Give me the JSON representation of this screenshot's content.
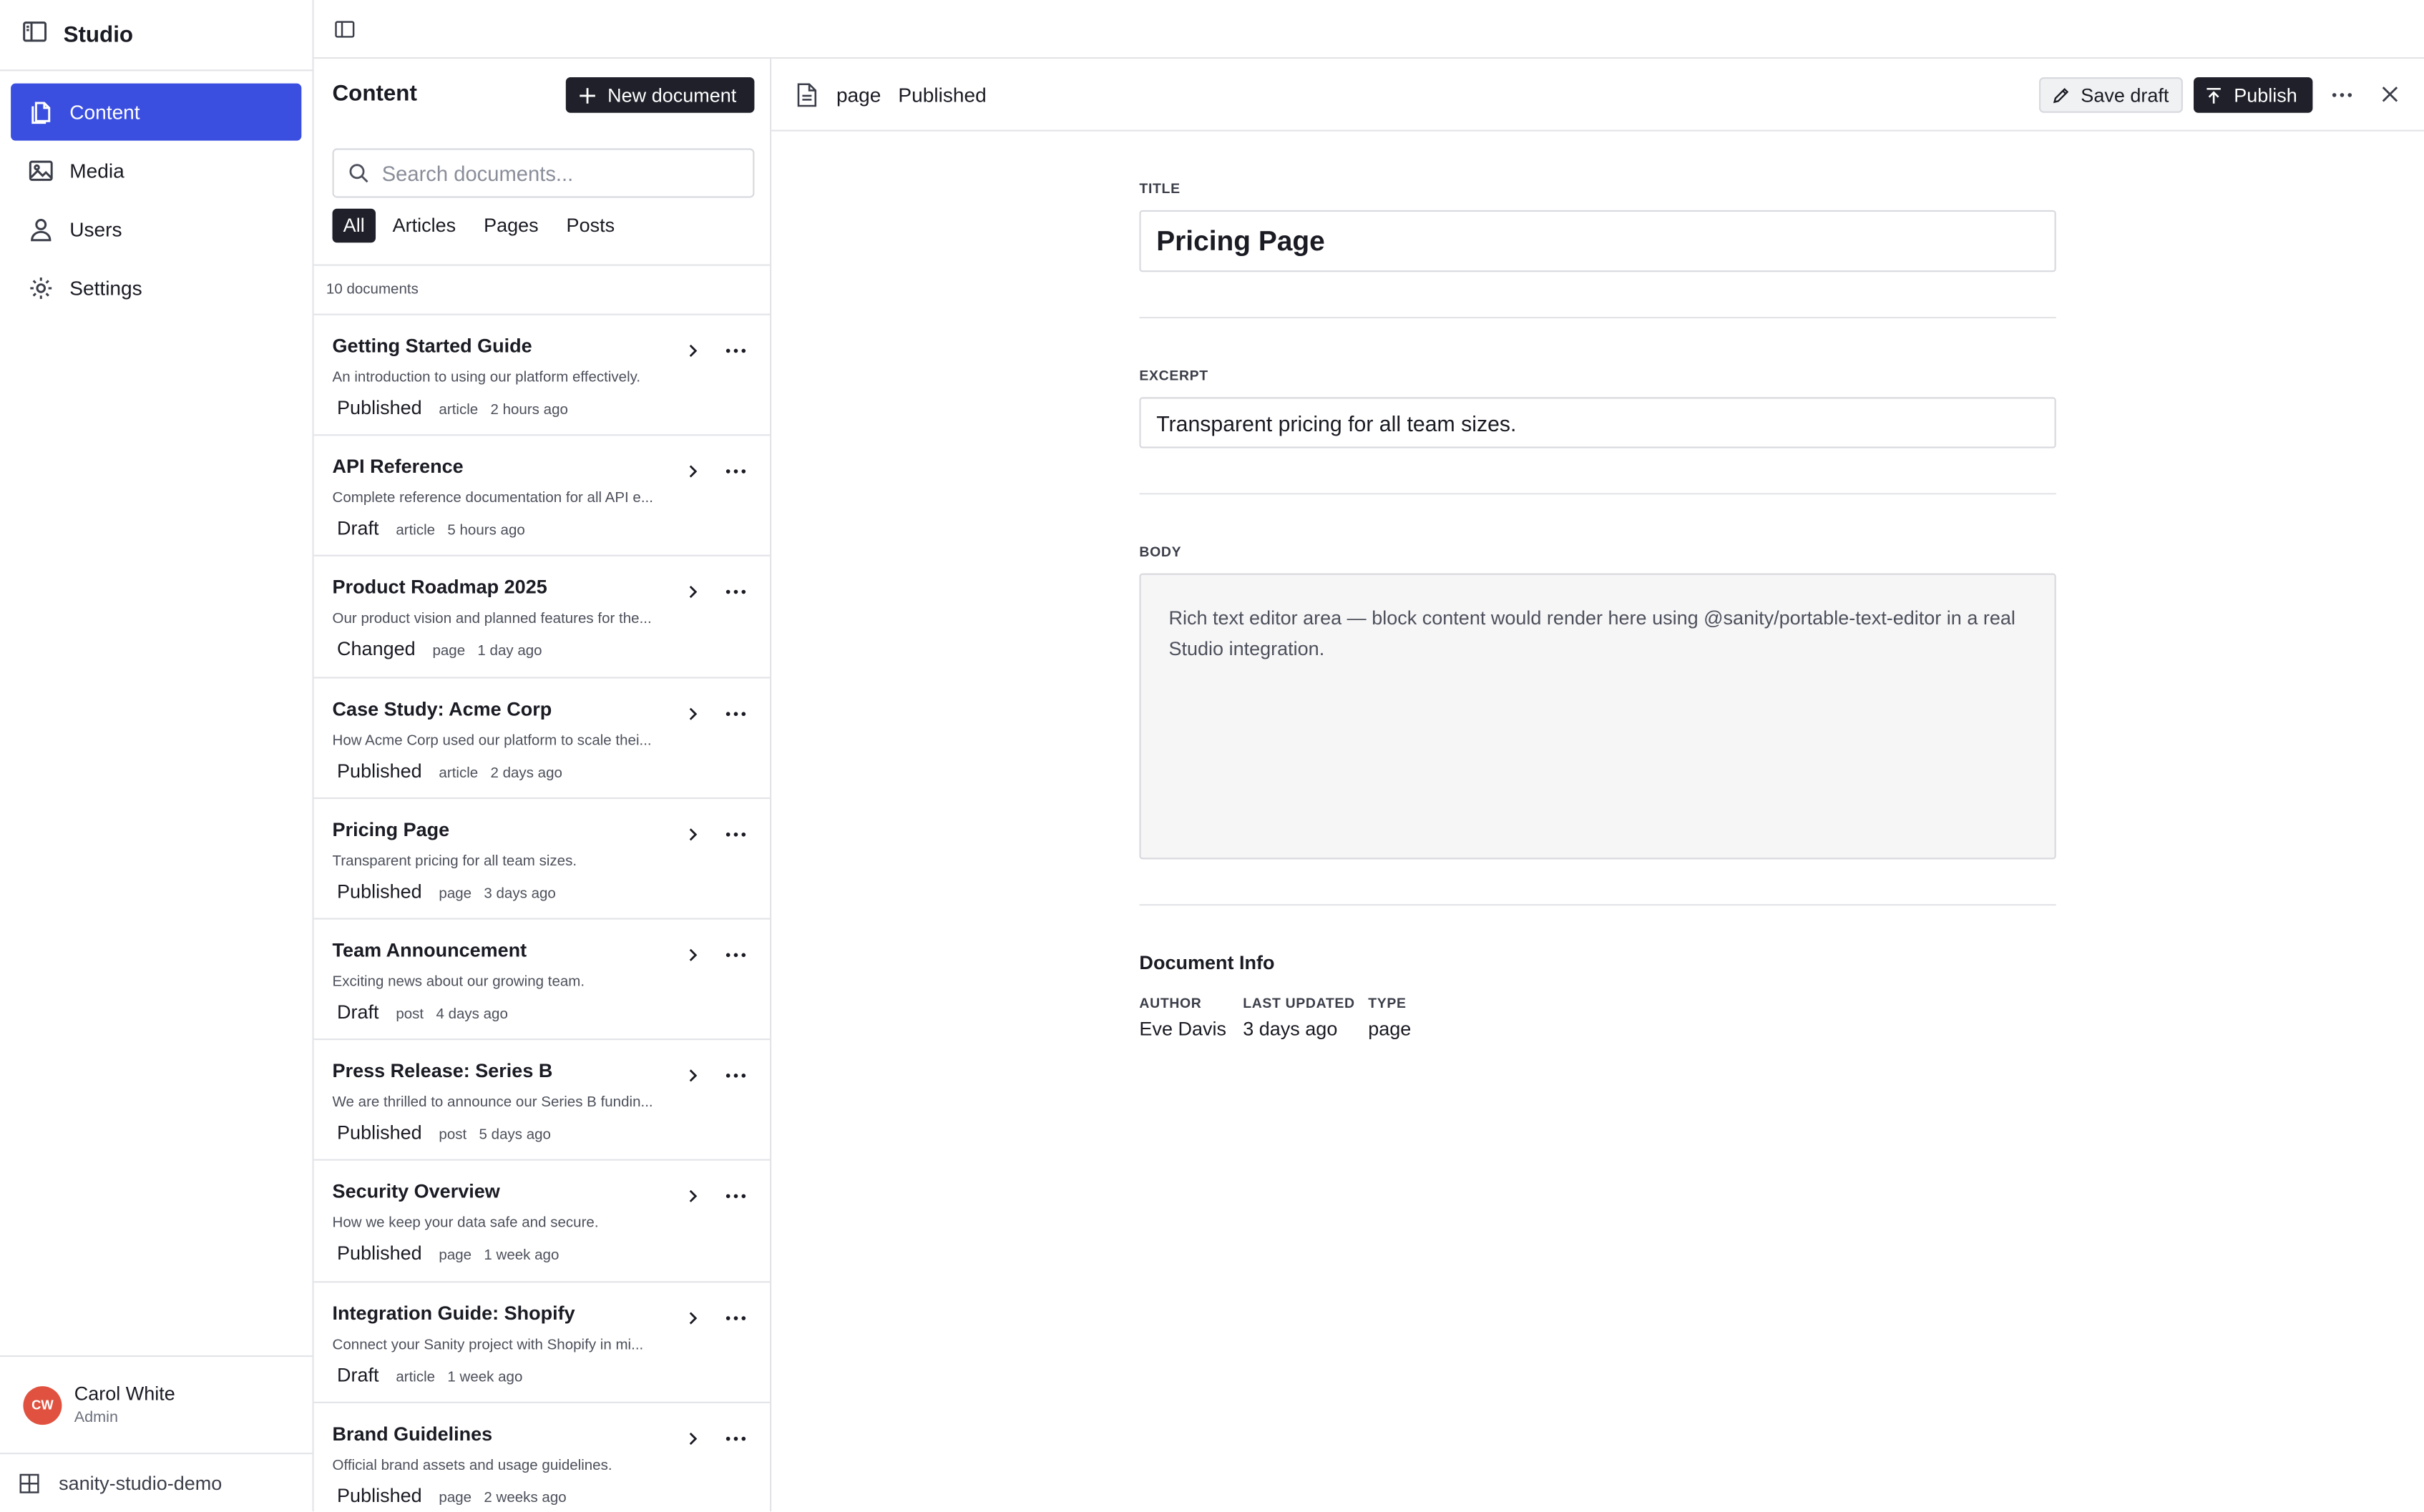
{
  "app": {
    "title": "Studio",
    "project": "sanity-studio-demo"
  },
  "sidebar": {
    "items": [
      {
        "label": "Content",
        "icon": "documents-icon",
        "active": true
      },
      {
        "label": "Media",
        "icon": "image-icon",
        "active": false
      },
      {
        "label": "Users",
        "icon": "users-icon",
        "active": false
      },
      {
        "label": "Settings",
        "icon": "gear-icon",
        "active": false
      }
    ],
    "user": {
      "initials": "CW",
      "name": "Carol White",
      "role": "Admin"
    }
  },
  "list": {
    "title": "Content",
    "new_button": "New document",
    "search_placeholder": "Search documents...",
    "filters": [
      "All",
      "Articles",
      "Pages",
      "Posts"
    ],
    "active_filter": "All",
    "count": "10 documents",
    "documents": [
      {
        "title": "Getting Started Guide",
        "description": "An introduction to using our platform effectively.",
        "status": "Published",
        "type": "article",
        "time": "2 hours ago"
      },
      {
        "title": "API Reference",
        "description": "Complete reference documentation for all API e...",
        "status": "Draft",
        "type": "article",
        "time": "5 hours ago"
      },
      {
        "title": "Product Roadmap 2025",
        "description": "Our product vision and planned features for the...",
        "status": "Changed",
        "type": "page",
        "time": "1 day ago"
      },
      {
        "title": "Case Study: Acme Corp",
        "description": "How Acme Corp used our platform to scale thei...",
        "status": "Published",
        "type": "article",
        "time": "2 days ago"
      },
      {
        "title": "Pricing Page",
        "description": "Transparent pricing for all team sizes.",
        "status": "Published",
        "type": "page",
        "time": "3 days ago"
      },
      {
        "title": "Team Announcement",
        "description": "Exciting news about our growing team.",
        "status": "Draft",
        "type": "post",
        "time": "4 days ago"
      },
      {
        "title": "Press Release: Series B",
        "description": "We are thrilled to announce our Series B fundin...",
        "status": "Published",
        "type": "post",
        "time": "5 days ago"
      },
      {
        "title": "Security Overview",
        "description": "How we keep your data safe and secure.",
        "status": "Published",
        "type": "page",
        "time": "1 week ago"
      },
      {
        "title": "Integration Guide: Shopify",
        "description": "Connect your Sanity project with Shopify in mi...",
        "status": "Draft",
        "type": "article",
        "time": "1 week ago"
      },
      {
        "title": "Brand Guidelines",
        "description": "Official brand assets and usage guidelines.",
        "status": "Published",
        "type": "page",
        "time": "2 weeks ago"
      }
    ]
  },
  "editor": {
    "doc_type": "page",
    "doc_status": "Published",
    "save_label": "Save draft",
    "publish_label": "Publish",
    "fields": {
      "title_label": "TITLE",
      "title_value": "Pricing Page",
      "excerpt_label": "EXCERPT",
      "excerpt_value": "Transparent pricing for all team sizes.",
      "body_label": "BODY",
      "body_value": "Rich text editor area — block content would render here using @sanity/portable-text-editor in a real Studio integration."
    },
    "info": {
      "title": "Document Info",
      "author_label": "AUTHOR",
      "author_value": "Eve Davis",
      "updated_label": "LAST UPDATED",
      "updated_value": "3 days ago",
      "type_label": "TYPE",
      "type_value": "page"
    }
  },
  "colors": {
    "accent": "#3a4ee0",
    "dark_button": "#1f2029",
    "avatar": "#e0523f",
    "border": "#e3e4e8"
  }
}
